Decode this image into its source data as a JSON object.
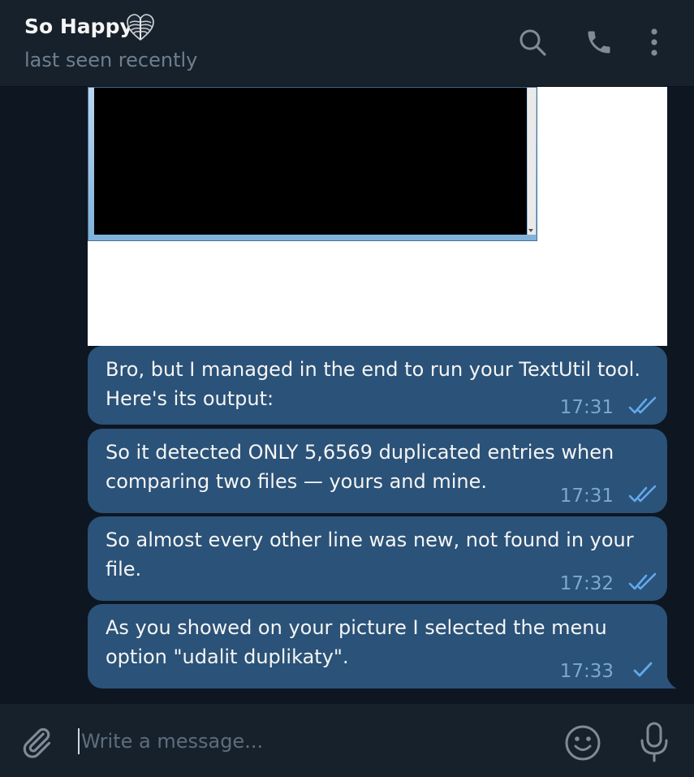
{
  "header": {
    "title": "So Happy",
    "title_emoji": "heart-xray-emoji",
    "status": "last seen recently",
    "actions": [
      "search-icon",
      "phone-icon",
      "more-vertical-icon"
    ]
  },
  "messages": [
    {
      "type": "image",
      "icon": "console-screenshot"
    },
    {
      "text": "Bro, but I managed in the end to run your TextUtil tool. Here's its output:",
      "time": "17:31",
      "status": "read"
    },
    {
      "text": "So it detected ONLY 5,6569 duplicated entries when comparing two files — yours and mine.",
      "time": "17:31",
      "status": "read"
    },
    {
      "text": "So almost every other line was new, not found in your file.",
      "time": "17:32",
      "status": "read"
    },
    {
      "text": "As you showed on your picture I selected the menu option \"udalit duplikaty\".",
      "time": "17:33",
      "status": "sent"
    }
  ],
  "composer": {
    "placeholder": "Write a message...",
    "value": ""
  },
  "colors": {
    "background": "#0e1621",
    "header": "#17212b",
    "bubble_out": "#2b5278",
    "time": "#7da8d3",
    "check": "#62a9ec",
    "icon": "#7f8b97"
  }
}
